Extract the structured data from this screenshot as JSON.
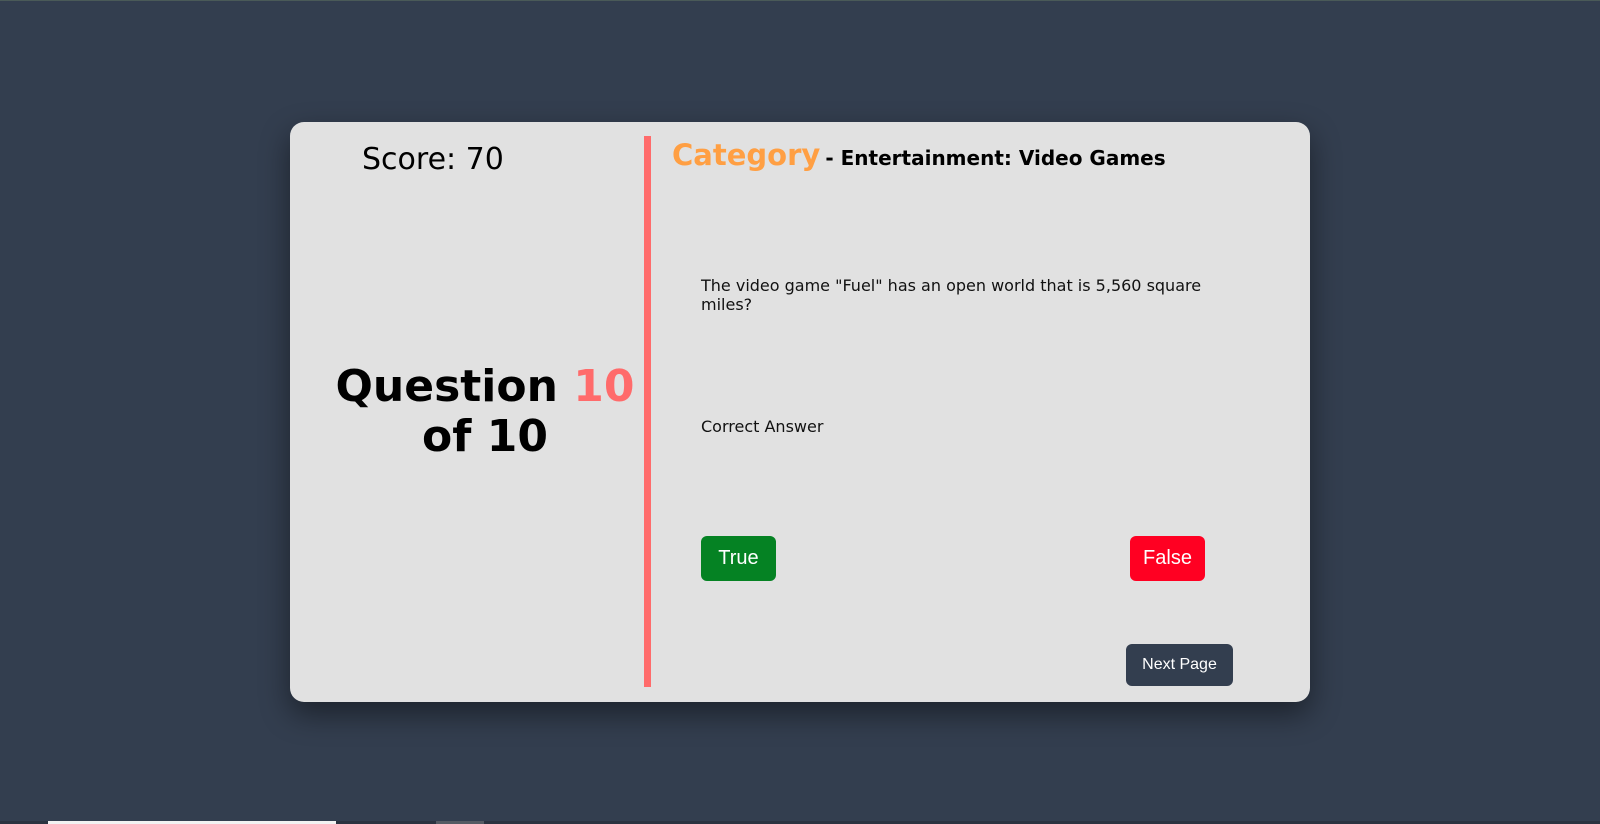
{
  "score": {
    "label": "Score: 70"
  },
  "counter": {
    "prefix": "Question",
    "current": "10",
    "suffix": "of 10"
  },
  "category": {
    "label": "Category",
    "name": "- Entertainment: Video Games"
  },
  "question": {
    "text": "The video game \"Fuel\" has an open world that is 5,560 square miles?"
  },
  "result": {
    "text": "Correct Answer"
  },
  "answers": {
    "true_label": "True",
    "false_label": "False"
  },
  "navigation": {
    "next_label": "Next Page"
  },
  "colors": {
    "background": "#333e4f",
    "card": "#e1e1e1",
    "accent_red": "#ff6b6b",
    "category_orange": "#ff9f43",
    "true_green": "#058223",
    "false_red": "#ff0022"
  }
}
